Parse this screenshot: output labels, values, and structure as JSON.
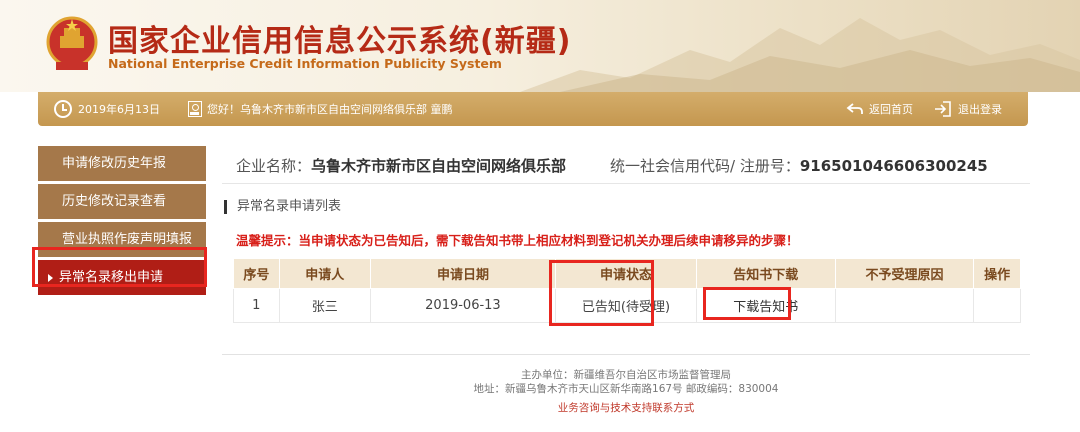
{
  "header": {
    "title_main": "国家企业信用信息公示系统",
    "title_region": "(新疆)",
    "subtitle": "National Enterprise Credit Information Publicity System"
  },
  "infobar": {
    "date": "2019年6月13日",
    "greeting": "您好！乌鲁木齐市新市区自由空间网络俱乐部  童鹏",
    "home_label": "返回首页",
    "logout_label": "退出登录"
  },
  "sidebar": {
    "items": [
      {
        "label": "申请修改历史年报"
      },
      {
        "label": "历史修改记录查看"
      },
      {
        "label": "营业执照作废声明填报"
      },
      {
        "label": "异常名录移出申请"
      }
    ]
  },
  "company": {
    "name_label": "企业名称：",
    "name_value": "乌鲁木齐市新市区自由空间网络俱乐部",
    "code_label": "统一社会信用代码/ 注册号：",
    "code_value": "916501046606300245"
  },
  "section": {
    "title": "异常名录申请列表",
    "warning": "温馨提示：当申请状态为已告知后，需下载告知书带上相应材料到登记机关办理后续申请移异的步骤！"
  },
  "table": {
    "headers": [
      "序号",
      "申请人",
      "申请日期",
      "申请状态",
      "告知书下载",
      "不予受理原因",
      "操作"
    ],
    "rows": [
      {
        "index": "1",
        "applicant": "张三",
        "date": "2019-06-13",
        "status": "已告知(待受理)",
        "download": "下载告知书",
        "reason": "",
        "action": ""
      }
    ]
  },
  "footer": {
    "sponsor": "主办单位：新疆维吾尔自治区市场监督管理局",
    "address": "地址：新疆乌鲁木齐市天山区新华南路167号    邮政编码：830004",
    "contact": "业务咨询与技术支持联系方式"
  },
  "colors": {
    "brand_red": "#b52a16",
    "bar_gold": "#c9a05c",
    "sidebar_brown": "#a5784a",
    "active_red": "#b01e16",
    "highlight_box": "#e8261f"
  }
}
